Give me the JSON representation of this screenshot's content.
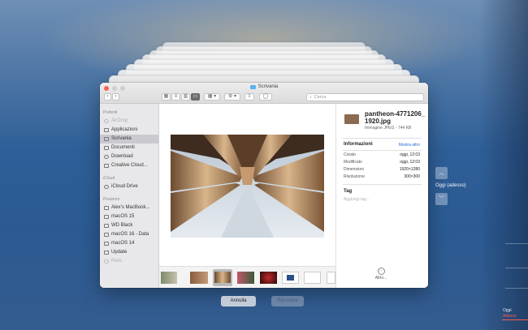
{
  "window": {
    "title": "Scrivania",
    "search_placeholder": "Cerca"
  },
  "sidebar": {
    "favorites_title": "Preferiti",
    "favorites": [
      {
        "label": "AirDrop",
        "icon": "airdrop-icon",
        "dimmed": true
      },
      {
        "label": "Applicazioni",
        "icon": "applications-icon"
      },
      {
        "label": "Scrivania",
        "icon": "desktop-icon",
        "selected": true
      },
      {
        "label": "Documenti",
        "icon": "documents-icon"
      },
      {
        "label": "Download",
        "icon": "download-icon"
      },
      {
        "label": "Creative Cloud...",
        "icon": "creative-cloud-icon"
      }
    ],
    "icloud_title": "iCloud",
    "icloud": [
      {
        "label": "iCloud Drive",
        "icon": "icloud-icon"
      }
    ],
    "locations_title": "Posizioni",
    "locations": [
      {
        "label": "Alex's MacBook...",
        "icon": "laptop-icon"
      },
      {
        "label": "macOS 15",
        "icon": "disk-icon"
      },
      {
        "label": "WD Black",
        "icon": "disk-icon"
      },
      {
        "label": "macOS 16 - Data",
        "icon": "disk-icon"
      },
      {
        "label": "macOS 14",
        "icon": "disk-icon"
      },
      {
        "label": "Update",
        "icon": "disk-icon"
      },
      {
        "label": "Rete",
        "icon": "network-icon",
        "dimmed": true
      }
    ]
  },
  "inspector": {
    "filename": "pantheon-4771206_1920.jpg",
    "filetype": "Immagine JPEG - 744 KB",
    "info_title": "Informazioni",
    "more_link": "Mostra altro",
    "rows": [
      {
        "key": "Creato",
        "value": "oggi, 12:03"
      },
      {
        "key": "Modificato",
        "value": "oggi, 12:03"
      },
      {
        "key": "Dimensioni",
        "value": "1920×1280"
      },
      {
        "key": "Risoluzione",
        "value": "300×300"
      }
    ],
    "tag_title": "Tag",
    "tag_placeholder": "Aggiungi tag...",
    "other_label": "Altro..."
  },
  "buttons": {
    "cancel": "Annulla",
    "restore": "Ripristina"
  },
  "timemachine": {
    "current_label": "Oggi (adesso)",
    "timeline_today": "Oggi",
    "timeline_now": "Adesso"
  },
  "colors": {
    "accent": "#2a6bd6",
    "close": "#fc5f57",
    "now_marker": "#ff5a50"
  }
}
